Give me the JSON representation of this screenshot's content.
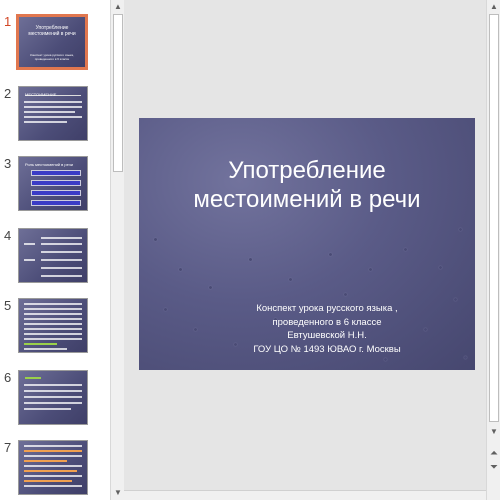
{
  "thumbnails": [
    {
      "num": "1",
      "title": "Употребление местоимений в речи",
      "subtitle": "Конспект урока русского языка, проведенного в 6 классе"
    },
    {
      "num": "2",
      "heading": "МЕСТОИМЕНИЕ",
      "text": "Самостоятельная часть речи, обозначающая на предмет, признаки или количество, не называя их"
    },
    {
      "num": "3",
      "heading": "Роль местоимений в речи",
      "items": [
        "Самостоятельные",
        "Указательные",
        "Притяжательные",
        "Возвратные"
      ]
    },
    {
      "num": "4"
    },
    {
      "num": "5"
    },
    {
      "num": "6",
      "text": "Вывод: местоимения служат для выразительности речи, помогают избегать ненужных повторов в повествовании."
    },
    {
      "num": "7"
    }
  ],
  "slide": {
    "title_line1": "Употребление",
    "title_line2": "местоимений в речи",
    "subtitle_lines": [
      "Конспект урока русского языка ,",
      "проведенного в 6 классе",
      "Евтушевской Н.Н.",
      "ГОУ ЦО № 1493  ЮВАО  г. Москвы"
    ]
  },
  "icons": {
    "scroll_up": "▲",
    "scroll_down": "▼",
    "prev_slide": "⏶",
    "next_slide": "⏷"
  },
  "colors": {
    "active_thumb_border": "#e1774f",
    "active_number": "#d24726",
    "slide_bg": "#5a5b87"
  }
}
